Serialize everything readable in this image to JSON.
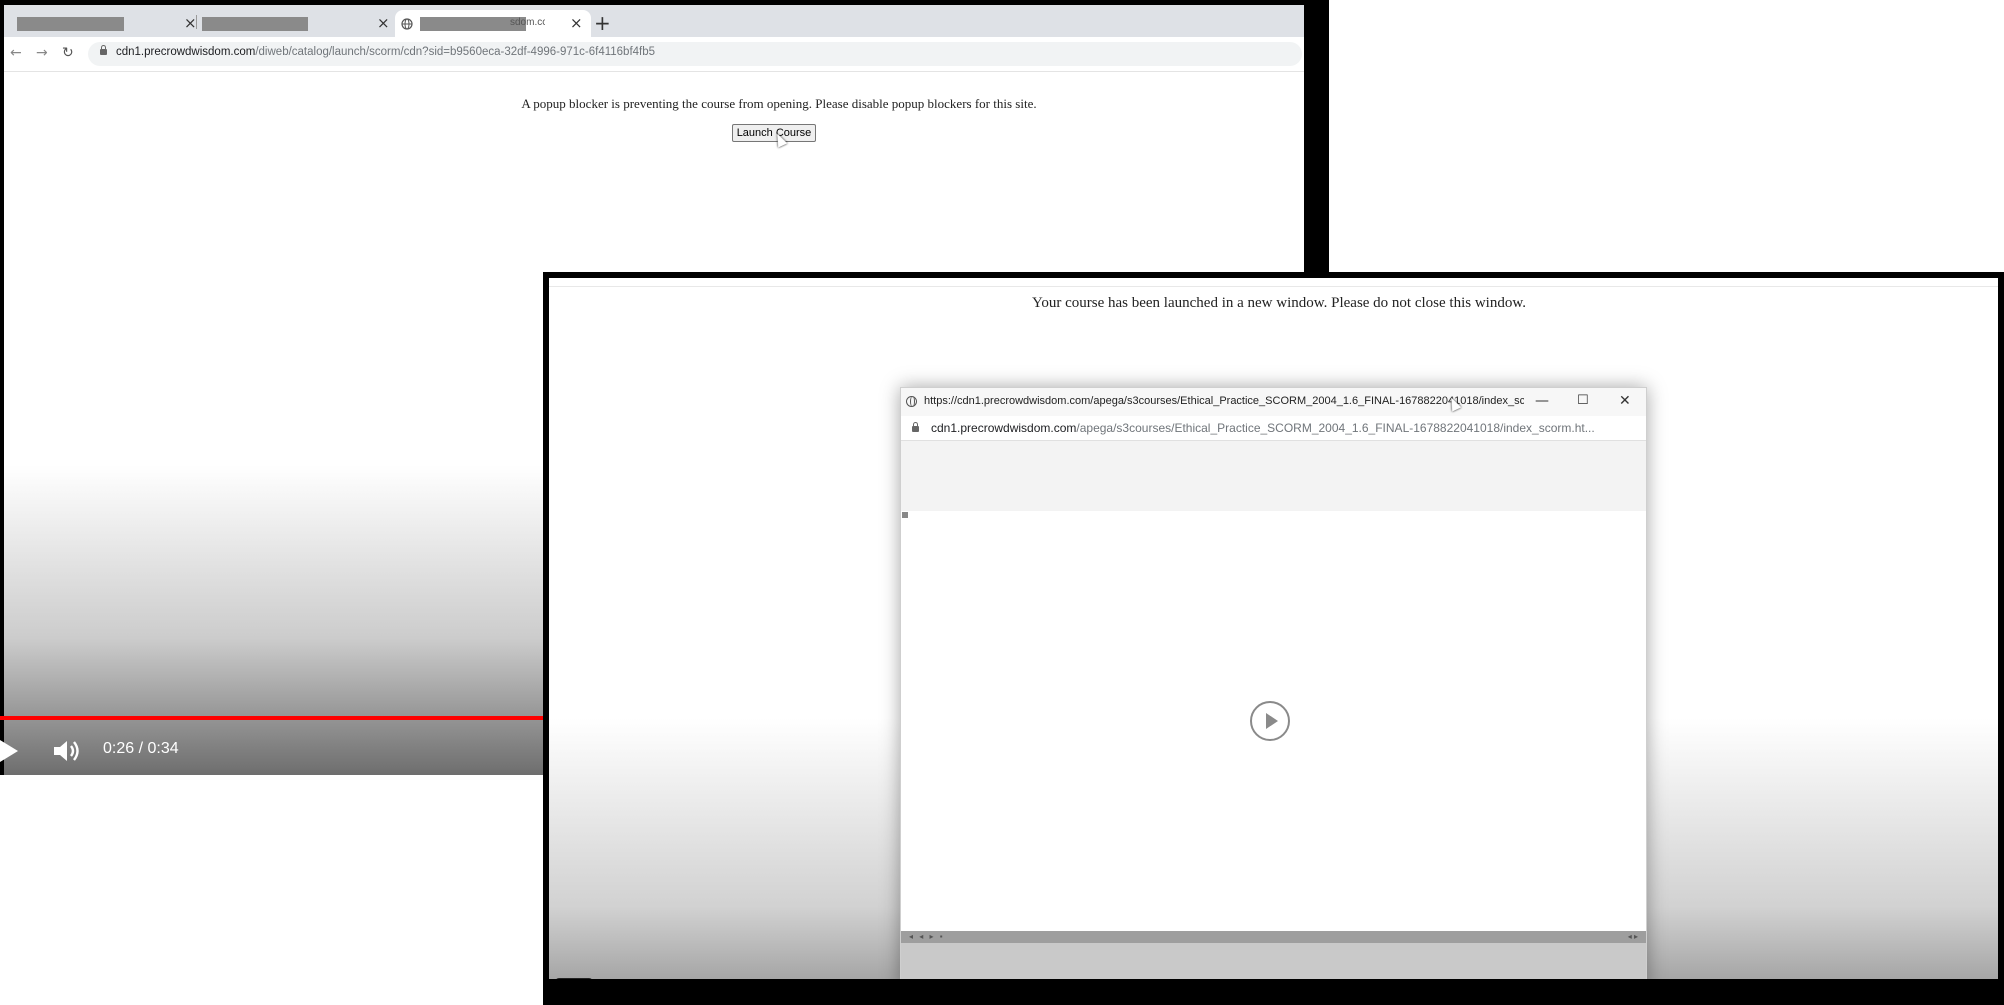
{
  "video1": {
    "browser": {
      "tabs": [
        {
          "title": "",
          "redacted": true,
          "active": false
        },
        {
          "title": "",
          "redacted": true,
          "active": false
        },
        {
          "title": "sdom.cc",
          "redacted": true,
          "active": true
        }
      ],
      "tab_close_glyph": "×",
      "new_tab_glyph": "+",
      "nav": {
        "back": "←",
        "forward": "→",
        "reload": "↻"
      },
      "url_host": "cdn1.precrowdwisdom.com",
      "url_path": "/diweb/catalog/launch/scorm/cdn?sid=b9560eca-32df-4996-971c-6f4116bf4fb5"
    },
    "page": {
      "message": "A popup blocker is preventing the course from opening. Please disable popup blockers for this site.",
      "launch_button_label": "Launch Course"
    },
    "player": {
      "time": "0:26 / 0:34",
      "progress_fraction": 0.765,
      "progress_color": "#ff0000",
      "icons": {
        "play": "play-icon",
        "volume": "volume-icon"
      }
    }
  },
  "video2": {
    "page": {
      "message": "Your course has been launched in a new window. Please do not close this window."
    },
    "popup": {
      "title": "https://cdn1.precrowdwisdom.com/apega/s3courses/Ethical_Practice_SCORM_2004_1.6_FINAL-1678822041018/index_sc...",
      "address_host": "cdn1.precrowdwisdom.com",
      "address_path": "/apega/s3courses/Ethical_Practice_SCORM_2004_1.6_FINAL-1678822041018/index_scorm.ht...",
      "controls": {
        "minimize": "—",
        "maximize": "☐",
        "close": "✕"
      },
      "play_icon": "play-circle-icon"
    }
  }
}
